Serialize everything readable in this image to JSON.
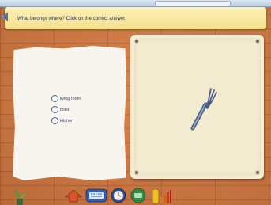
{
  "question": "What belongs where? Click on the correct answer.",
  "options": [
    {
      "label": "living room",
      "selected": false
    },
    {
      "label": "toilet",
      "selected": false
    },
    {
      "label": "kitchen",
      "selected": false
    }
  ],
  "picture_icon": "fork-icon",
  "toolbar_icons": [
    "plant-icon",
    "back-arrow-icon",
    "keyboard-icon",
    "clock-icon",
    "disk-icon",
    "level-bars-icon"
  ],
  "colors": {
    "banner": "#f5e08c",
    "question_text": "#1f2b5a",
    "option_text": "#3a4a78",
    "wall": "#cf7a45",
    "board": "#efe6c9"
  }
}
